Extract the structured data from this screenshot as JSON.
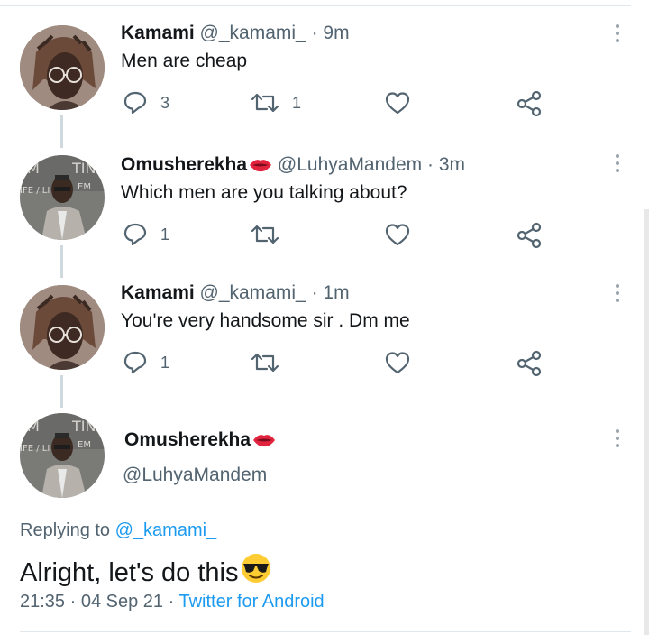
{
  "colors": {
    "accent": "#1d9bf0",
    "secondary_text": "#536471",
    "primary_text": "#14171a"
  },
  "thread": [
    {
      "name": "Kamami",
      "handle": "@_kamami_",
      "dot": "·",
      "time": "9m",
      "text": "Men are cheap",
      "reply_count": "3",
      "retweet_count": "1",
      "like_count": "",
      "avatar": "avatar-woman-glasses-braids"
    },
    {
      "name": "Omusherekha",
      "name_emoji": "lips-emoji",
      "handle": "@LuhyaMandem",
      "dot": "·",
      "time": "3m",
      "text": "Which men are you talking about?",
      "reply_count": "1",
      "retweet_count": "",
      "like_count": "",
      "avatar": "avatar-man-suit-glasses"
    },
    {
      "name": "Kamami",
      "handle": "@_kamami_",
      "dot": "·",
      "time": "1m",
      "text": "You're very handsome sir . Dm me",
      "reply_count": "1",
      "retweet_count": "",
      "like_count": "",
      "avatar": "avatar-woman-glasses-braids"
    }
  ],
  "focused": {
    "name": "Omusherekha",
    "name_emoji": "lips-emoji",
    "handle": "@LuhyaMandem",
    "replying_prefix": "Replying to",
    "replying_to": "@_kamami_",
    "text": "Alright, let's do this",
    "text_emoji": "smiling-face-with-sunglasses-emoji",
    "time": "21:35",
    "date": "04 Sep 21",
    "sep": "·",
    "source": "Twitter for Android"
  }
}
